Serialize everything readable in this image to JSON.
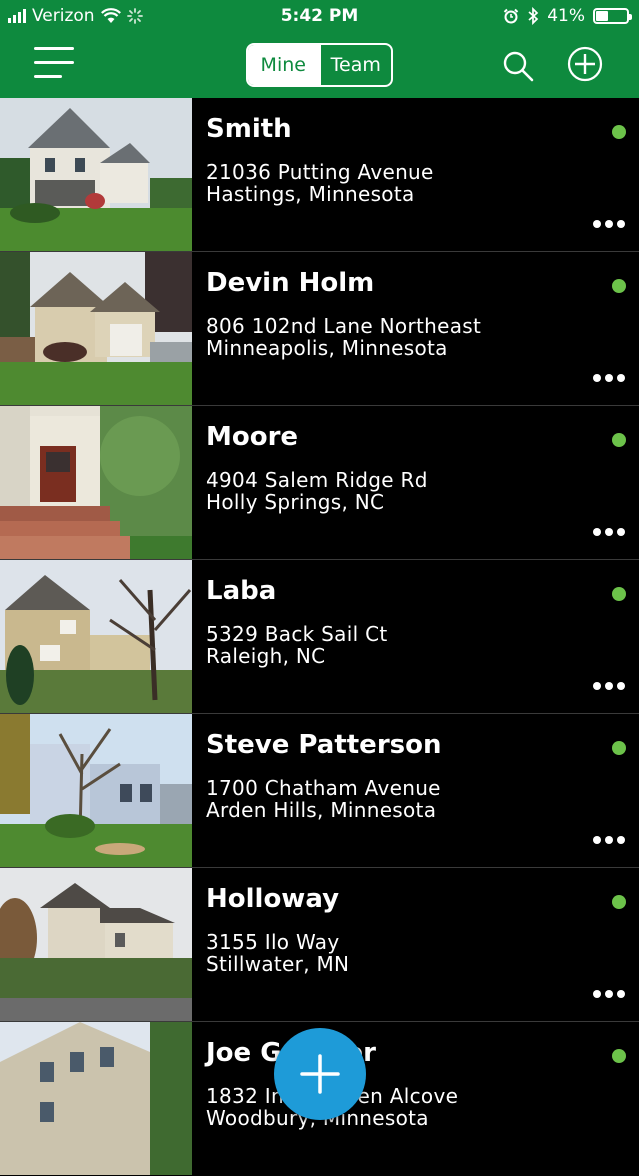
{
  "status_bar": {
    "carrier": "Verizon",
    "time": "5:42 PM",
    "battery": "41%",
    "battery_level": 0.41
  },
  "header": {
    "segment": {
      "mine_label": "Mine",
      "team_label": "Team",
      "selected": "Mine"
    },
    "icons": [
      "menu-icon",
      "search-icon",
      "add-circle-icon"
    ],
    "color": "#0e8a3e"
  },
  "listings": [
    {
      "name": "Smith",
      "address1": "21036 Putting Avenue",
      "address2": "Hastings, Minnesota"
    },
    {
      "name": "Devin Holm",
      "address1": "806 102nd Lane Northeast",
      "address2": "Minneapolis, Minnesota"
    },
    {
      "name": "Moore",
      "address1": "4904 Salem Ridge Rd",
      "address2": "Holly Springs, NC"
    },
    {
      "name": "Laba",
      "address1": "5329 Back Sail Ct",
      "address2": "Raleigh, NC"
    },
    {
      "name": "Steve Patterson",
      "address1": "1700 Chatham Avenue",
      "address2": "Arden Hills, Minnesota"
    },
    {
      "name": "Holloway",
      "address1": "3155 Ilo Way",
      "address2": "Stillwater, MN"
    },
    {
      "name": "Joe Gondier",
      "address1": "1832 Inman Glen Alcove",
      "address2": "Woodbury, Minnesota"
    }
  ],
  "status_color": "#6cc24a",
  "fab_color": "#1e9bd8"
}
